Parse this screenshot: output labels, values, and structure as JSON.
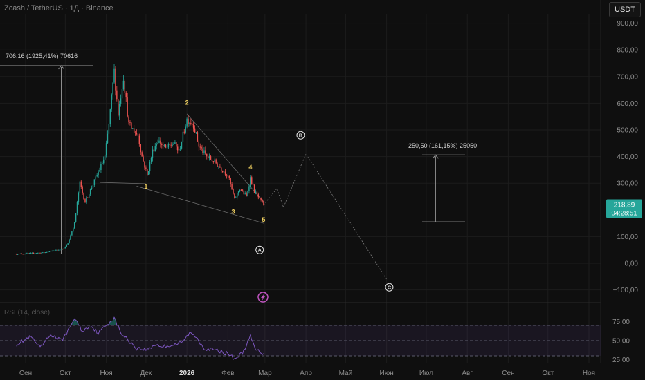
{
  "header": {
    "title": "Zcash / TetherUS · 1Д · Binance",
    "currency": "USDT"
  },
  "price_axis": {
    "labels": [
      "900,00",
      "800,00",
      "700,00",
      "600,00",
      "500,00",
      "400,00",
      "300,00",
      "100,00",
      "0,00",
      "−100,00"
    ],
    "values": [
      900,
      800,
      700,
      600,
      500,
      400,
      300,
      100,
      0,
      -100
    ],
    "last_price": "218,89",
    "countdown": "04:28:51",
    "last_price_value": 218.89,
    "accent": "#26a69a",
    "down_color": "#ef5350"
  },
  "time_axis": {
    "labels": [
      "Сен",
      "Окт",
      "Ноя",
      "Дек",
      "2026",
      "Фев",
      "Мар",
      "Апр",
      "Май",
      "Июн",
      "Июл",
      "Авг",
      "Сен",
      "Окт",
      "Ноя"
    ],
    "bold_label": "2026",
    "start": "2025-09-01",
    "dates": [
      "2025-09-01",
      "2025-10-01",
      "2025-11-01",
      "2025-12-01",
      "2026-01-01",
      "2026-02-01",
      "2026-03-01",
      "2026-04-01",
      "2026-05-01",
      "2026-06-01",
      "2026-07-01",
      "2026-08-01",
      "2026-09-01",
      "2026-10-01",
      "2026-11-01"
    ]
  },
  "rsi": {
    "label": "RSI (14, close)",
    "labels": [
      "75,00",
      "50,00",
      "25,00"
    ],
    "levels": [
      70,
      50,
      30
    ],
    "values": [
      75,
      50,
      25
    ],
    "line_color": "#7e57c2"
  },
  "chart_data": {
    "type": "candlestick",
    "symbol": "Zcash / TetherUS",
    "interval": "1Д",
    "exchange": "Binance",
    "ylim": [
      -150,
      950
    ],
    "keypoints": [
      {
        "date": "2025-08-25",
        "price": 35
      },
      {
        "date": "2025-09-15",
        "price": 40
      },
      {
        "date": "2025-09-30",
        "price": 55
      },
      {
        "date": "2025-10-03",
        "price": 75
      },
      {
        "date": "2025-10-08",
        "price": 150
      },
      {
        "date": "2025-10-12",
        "price": 300
      },
      {
        "date": "2025-10-16",
        "price": 230
      },
      {
        "date": "2025-10-25",
        "price": 330
      },
      {
        "date": "2025-10-31",
        "price": 400
      },
      {
        "date": "2025-11-03",
        "price": 520
      },
      {
        "date": "2025-11-07",
        "price": 720
      },
      {
        "date": "2025-11-10",
        "price": 560
      },
      {
        "date": "2025-11-14",
        "price": 700
      },
      {
        "date": "2025-11-18",
        "price": 520
      },
      {
        "date": "2025-11-25",
        "price": 480
      },
      {
        "date": "2025-11-28",
        "price": 400
      },
      {
        "date": "2025-12-02",
        "price": 330
      },
      {
        "date": "2025-12-06",
        "price": 420
      },
      {
        "date": "2025-12-10",
        "price": 460
      },
      {
        "date": "2025-12-16",
        "price": 430
      },
      {
        "date": "2025-12-22",
        "price": 450
      },
      {
        "date": "2025-12-26",
        "price": 420
      },
      {
        "date": "2026-01-01",
        "price": 540
      },
      {
        "date": "2026-01-06",
        "price": 520
      },
      {
        "date": "2026-01-10",
        "price": 440
      },
      {
        "date": "2026-01-16",
        "price": 400
      },
      {
        "date": "2026-01-22",
        "price": 380
      },
      {
        "date": "2026-01-28",
        "price": 350
      },
      {
        "date": "2026-02-01",
        "price": 330
      },
      {
        "date": "2026-02-06",
        "price": 240
      },
      {
        "date": "2026-02-10",
        "price": 280
      },
      {
        "date": "2026-02-15",
        "price": 250
      },
      {
        "date": "2026-02-18",
        "price": 320
      },
      {
        "date": "2026-02-21",
        "price": 270
      },
      {
        "date": "2026-02-25",
        "price": 240
      },
      {
        "date": "2026-02-28",
        "price": 219
      }
    ],
    "rsi_keypoints": [
      {
        "date": "2025-08-25",
        "v": 45
      },
      {
        "date": "2025-09-05",
        "v": 55
      },
      {
        "date": "2025-09-12",
        "v": 40
      },
      {
        "date": "2025-09-20",
        "v": 58
      },
      {
        "date": "2025-09-28",
        "v": 50
      },
      {
        "date": "2025-10-04",
        "v": 65
      },
      {
        "date": "2025-10-08",
        "v": 80
      },
      {
        "date": "2025-10-14",
        "v": 62
      },
      {
        "date": "2025-10-20",
        "v": 70
      },
      {
        "date": "2025-10-26",
        "v": 60
      },
      {
        "date": "2025-11-02",
        "v": 72
      },
      {
        "date": "2025-11-07",
        "v": 80
      },
      {
        "date": "2025-11-12",
        "v": 60
      },
      {
        "date": "2025-11-18",
        "v": 50
      },
      {
        "date": "2025-11-24",
        "v": 40
      },
      {
        "date": "2025-12-02",
        "v": 38
      },
      {
        "date": "2025-12-08",
        "v": 45
      },
      {
        "date": "2025-12-14",
        "v": 42
      },
      {
        "date": "2025-12-20",
        "v": 44
      },
      {
        "date": "2025-12-28",
        "v": 47
      },
      {
        "date": "2026-01-03",
        "v": 60
      },
      {
        "date": "2026-01-08",
        "v": 55
      },
      {
        "date": "2026-01-14",
        "v": 40
      },
      {
        "date": "2026-01-20",
        "v": 38
      },
      {
        "date": "2026-01-26",
        "v": 36
      },
      {
        "date": "2026-02-02",
        "v": 32
      },
      {
        "date": "2026-02-06",
        "v": 26
      },
      {
        "date": "2026-02-12",
        "v": 34
      },
      {
        "date": "2026-02-18",
        "v": 55
      },
      {
        "date": "2026-02-22",
        "v": 38
      },
      {
        "date": "2026-02-28",
        "v": 33
      }
    ],
    "wave_labels": [
      {
        "text": "1",
        "date": "2025-12-01",
        "price": 280
      },
      {
        "text": "2",
        "date": "2026-01-01",
        "price": 595
      },
      {
        "text": "3",
        "date": "2026-02-05",
        "price": 185
      },
      {
        "text": "4",
        "date": "2026-02-18",
        "price": 352
      },
      {
        "text": "5",
        "date": "2026-02-28",
        "price": 155
      }
    ],
    "abc_labels": [
      {
        "text": "A",
        "date": "2026-02-25",
        "price": 50
      },
      {
        "text": "B",
        "date": "2026-03-28",
        "price": 480
      },
      {
        "text": "C",
        "date": "2026-06-03",
        "price": -90
      }
    ],
    "projection_path": [
      {
        "date": "2026-02-28",
        "price": 219
      },
      {
        "date": "2026-03-10",
        "price": 280
      },
      {
        "date": "2026-03-15",
        "price": 210
      },
      {
        "date": "2026-04-01",
        "price": 410
      },
      {
        "date": "2026-06-01",
        "price": -60
      }
    ],
    "measure_1": {
      "text": "706,16 (1925,41%) 70616",
      "date": "2025-09-28",
      "low": 35,
      "high": 741
    },
    "measure_2": {
      "text": "250,50 (161,15%) 25050",
      "date": "2026-07-08",
      "low": 155,
      "high": 406
    }
  }
}
